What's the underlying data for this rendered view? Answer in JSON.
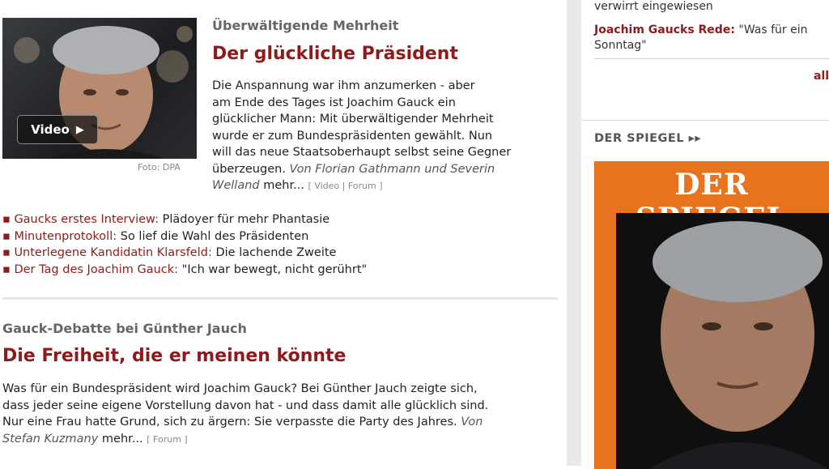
{
  "story1": {
    "video_label": "Video",
    "photo_credit": "Foto: DPA",
    "kicker": "Überwältigende Mehrheit",
    "headline": "Der glückliche Präsident",
    "teaser_lines": [
      "Die Anspannung war ihm anzumerken - aber",
      "am Ende des Tages ist Joachim Gauck ein",
      "glücklicher Mann: Mit überwältigender Mehrheit",
      "wurde er zum Bundespräsidenten gewählt. Nun",
      "will das neue Staatsoberhaupt selbst seine Gegner"
    ],
    "teaser_last": "überzeugen.",
    "byline": "Von Florian Gathmann und Severin",
    "byline2": "Welland",
    "more": "mehr...",
    "video_link": "Video",
    "forum_link": "Forum",
    "related": [
      {
        "link": "Gaucks erstes Interview:",
        "text": "Plädoyer für mehr Phantasie"
      },
      {
        "link": "Minutenprotokoll:",
        "text": "So lief die Wahl des Präsidenten"
      },
      {
        "link": "Unterlegene Kandidatin Klarsfeld:",
        "text": "Die lachende Zweite"
      },
      {
        "link": "Der Tag des Joachim Gauck:",
        "text": "\"Ich war bewegt, nicht gerührt\""
      }
    ]
  },
  "story2": {
    "kicker": "Gauck-Debatte bei Günther Jauch",
    "headline": "Die Freiheit, die er meinen könnte",
    "teaser_lines": [
      "Was für ein Bundespräsident wird Joachim Gauck? Bei Günther Jauch zeigte sich,",
      "dass jeder seine eigene Vorstellung davon hat - und dass damit alle glücklich sind."
    ],
    "teaser_last": "Nur eine Frau hatte Grund, sich zu ärgern: Sie verpasste die Party des Jahres.",
    "byline": "Von",
    "byline2": "Stefan Kuzmany",
    "more": "mehr...",
    "forum_link": "Forum"
  },
  "sidebar": {
    "top_line": "verwirrt eingewiesen",
    "speech_label": "Joachim Gaucks Rede:",
    "speech_text": "\"Was für ein",
    "speech_text2": "Sonntag\"",
    "all_link": "all",
    "spiegel_header": "DER SPIEGEL",
    "cover_title": "DER SPIEGEL",
    "colors": {
      "brand_red": "#8e1b1b",
      "cover_orange": "#e8731e"
    }
  }
}
